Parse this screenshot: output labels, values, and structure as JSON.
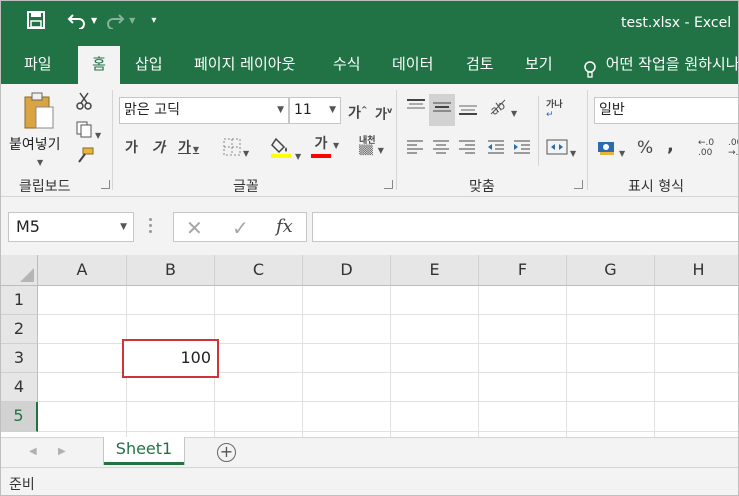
{
  "titlebar": {
    "title": "test.xlsx  -  Excel",
    "save_icon": "save-icon",
    "undo_icon": "undo-icon",
    "redo_icon": "redo-icon",
    "customize_icon": "customize-qat-icon"
  },
  "tabs": [
    {
      "label": "파일"
    },
    {
      "label": "홈"
    },
    {
      "label": "삽입"
    },
    {
      "label": "페이지 레이아웃"
    },
    {
      "label": "수식"
    },
    {
      "label": "데이터"
    },
    {
      "label": "검토"
    },
    {
      "label": "보기"
    }
  ],
  "tellme": "어떤 작업을 원하시나",
  "ribbon": {
    "clipboard": {
      "paste_label": "붙여넣기",
      "group_label": "클립보드"
    },
    "font": {
      "font_name": "맑은 고딕",
      "font_size": "11",
      "grow": "가",
      "shrink": "가",
      "bold": "가",
      "italic": "가",
      "underline": "가",
      "fontcolor": "가",
      "phonetic": "내천",
      "group_label": "글꼴"
    },
    "alignment": {
      "group_label": "맞춤",
      "wrap": "가나"
    },
    "number": {
      "format": "일반",
      "percent": "%",
      "comma": ",",
      "inc_decimal": "←.0\n.00",
      "dec_decimal": ".00\n→.0",
      "group_label": "표시 형식"
    }
  },
  "formula_bar": {
    "name_box": "M5",
    "cancel": "✕",
    "enter": "✓",
    "fx": "fx",
    "value": ""
  },
  "columns": [
    "A",
    "B",
    "C",
    "D",
    "E",
    "F",
    "G",
    "H"
  ],
  "rows": [
    "1",
    "2",
    "3",
    "4",
    "5"
  ],
  "cells": {
    "B3": "100"
  },
  "sheet_tabs": [
    {
      "label": "Sheet1",
      "active": true
    }
  ],
  "status": "준비",
  "colors": {
    "accent": "#217346",
    "highlight_box": "#d13438",
    "fill_yellow": "#ffff00",
    "font_red": "#ff0000"
  }
}
